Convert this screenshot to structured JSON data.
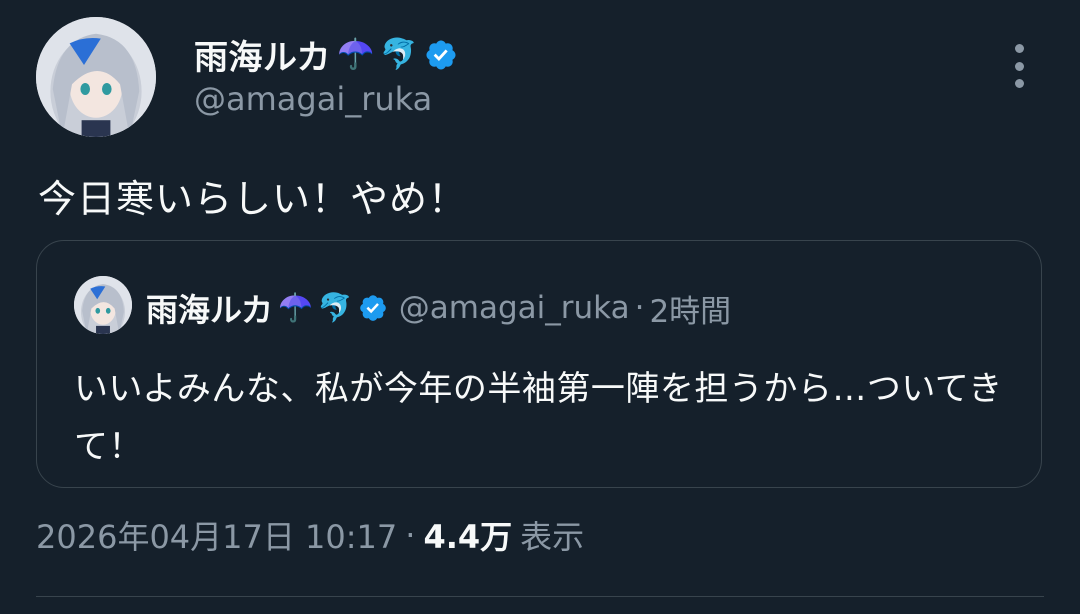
{
  "author": {
    "display_name": "雨海ルカ",
    "emoji_1": "☂️",
    "emoji_2": "🐬",
    "handle": "@amagai_ruka"
  },
  "tweet": {
    "text": "今日寒いらしい！やめ！"
  },
  "quoted": {
    "display_name": "雨海ルカ",
    "emoji_1": "☂️",
    "emoji_2": "🐬",
    "handle": "@amagai_ruka",
    "separator": "·",
    "time": "2時間",
    "text": "いいよみんな、私が今年の半袖第一陣を担うから…ついてきて！"
  },
  "meta": {
    "date": "2026年04月17日 10:17",
    "separator": "·",
    "views": "4.4万",
    "views_label": "表示"
  },
  "colors": {
    "background": "#15202b",
    "verified": "#1d9bf0",
    "secondary_text": "#8b98a5",
    "border": "#38444d"
  },
  "icons": [
    "avatar",
    "umbrella-emoji",
    "dolphin-emoji",
    "verified-badge-icon",
    "more-options-icon"
  ]
}
